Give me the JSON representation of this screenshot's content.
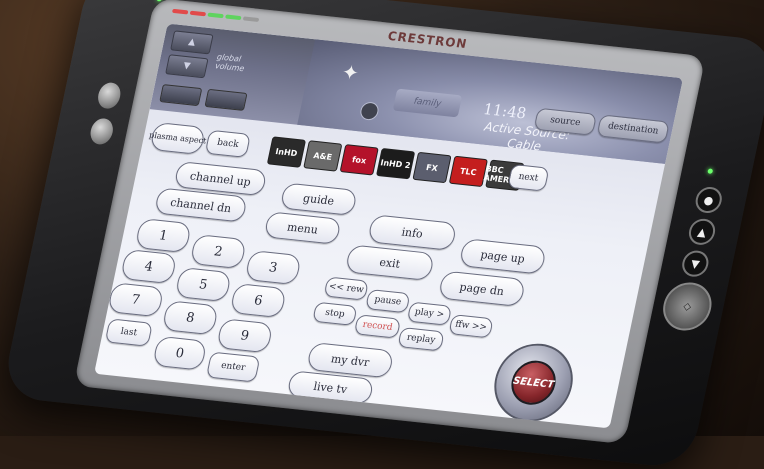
{
  "device": {
    "brand": "CRESTRON"
  },
  "header": {
    "global_volume_label": "global volume",
    "room_label": "family",
    "time": "11:48",
    "active_source_label": "Active Source:",
    "active_source_value": "Cable",
    "source_button": "source",
    "destination_button": "destination"
  },
  "channels": [
    {
      "label": "InHD",
      "bg": "#2a2a2a"
    },
    {
      "label": "A&E",
      "bg": "#6a6a6a"
    },
    {
      "label": "fox",
      "bg": "#b4122a"
    },
    {
      "label": "InHD 2",
      "bg": "#1c1c1c"
    },
    {
      "label": "FX",
      "bg": "#5b5e6e"
    },
    {
      "label": "TLC",
      "bg": "#c41e1e"
    },
    {
      "label": "BBC AMERICA",
      "bg": "#3b3b3b"
    }
  ],
  "buttons": {
    "plasma_aspect": "plasma aspect",
    "back": "back",
    "next": "next",
    "channel_up": "channel up",
    "channel_dn": "channel dn",
    "guide": "guide",
    "menu": "menu",
    "info": "info",
    "exit": "exit",
    "page_up": "page up",
    "page_dn": "page dn",
    "rew": "<< rew",
    "pause": "pause",
    "play": "play >",
    "ffw": "ffw >>",
    "stop": "stop",
    "record": "record",
    "replay": "replay",
    "my_dvr": "my dvr",
    "live_tv": "live tv",
    "last": "last",
    "enter": "enter",
    "select": "SELECT"
  },
  "keypad": [
    "1",
    "2",
    "3",
    "4",
    "5",
    "6",
    "7",
    "8",
    "9",
    "0"
  ],
  "colors": {
    "led_red": "#e14a4a",
    "led_green": "#5fd35f",
    "led_grey": "#9a9a9a",
    "select_red": "#86262b"
  }
}
